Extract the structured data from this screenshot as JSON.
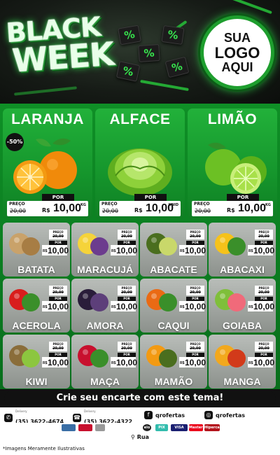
{
  "header": {
    "title_line1": "BLACK",
    "title_line2": "WEEK",
    "percent_symbol": "%",
    "logo_line1": "SUA",
    "logo_line2": "LOGO",
    "logo_line3": "AQUI"
  },
  "featured": [
    {
      "name": "LARANJA",
      "badge": "-50%",
      "por": "POR",
      "preco_label": "PREÇO",
      "old_price": "20,00",
      "currency": "R$",
      "price": "10,00",
      "unit": "KG",
      "icon": "orange-fruit"
    },
    {
      "name": "ALFACE",
      "por": "POR",
      "preco_label": "PREÇO",
      "old_price": "20,00",
      "currency": "R$",
      "price": "10,00",
      "unit": "UNID",
      "icon": "lettuce"
    },
    {
      "name": "LIMÃO",
      "por": "POR",
      "preco_label": "PREÇO",
      "old_price": "20,00",
      "currency": "R$",
      "price": "10,00",
      "unit": "KG",
      "icon": "lime"
    }
  ],
  "grid": [
    {
      "name": "BATATA",
      "icon": "potato"
    },
    {
      "name": "MARACUJÁ",
      "icon": "passion-fruit"
    },
    {
      "name": "ABACATE",
      "icon": "avocado"
    },
    {
      "name": "ABACAXI",
      "icon": "pineapple"
    },
    {
      "name": "ACEROLA",
      "icon": "acerola"
    },
    {
      "name": "AMORA",
      "icon": "blackberry"
    },
    {
      "name": "CAQUI",
      "icon": "persimmon"
    },
    {
      "name": "GOIABA",
      "icon": "guava"
    },
    {
      "name": "KIWI",
      "icon": "kiwi"
    },
    {
      "name": "MAÇA",
      "icon": "apple"
    },
    {
      "name": "MAMÃO",
      "icon": "papaya"
    },
    {
      "name": "MANGA",
      "icon": "mango"
    }
  ],
  "grid_price": {
    "preco_label": "PREÇO",
    "old_price": "20,00",
    "por": "POR",
    "currency": "R$",
    "price": "10,00"
  },
  "cta": "Crie seu encarte com este tema!",
  "contacts": {
    "phone1_label": "Delivery",
    "phone1": "(35) 3622-4674",
    "phone2_label": "Delivery",
    "phone2": "(35) 3622-4322",
    "facebook": "qrofertas",
    "instagram": "qrofertas"
  },
  "payments": [
    "VISA",
    "MasterCard",
    "Hipercard",
    "elo",
    "PIX"
  ],
  "address": "Rua",
  "disclaimer": "*Imagens Meramente Ilustrativas",
  "colors": {
    "brand_green": "#15952c",
    "dark": "#111111",
    "neon": "#37e54e"
  }
}
